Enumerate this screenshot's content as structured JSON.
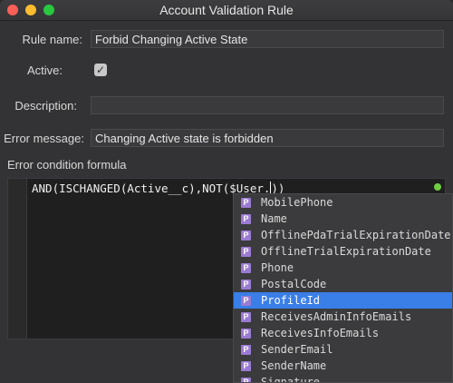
{
  "window": {
    "title": "Account Validation Rule"
  },
  "form": {
    "rule_name_label": "Rule name:",
    "rule_name_value": "Forbid Changing Active State",
    "active_label": "Active:",
    "active_checked": true,
    "active_check_glyph": "✓",
    "description_label": "Description:",
    "description_value": "",
    "error_message_label": "Error message:",
    "error_message_value": "Changing Active state is forbidden",
    "formula_label": "Error condition formula"
  },
  "editor": {
    "code_before_caret": "AND(ISCHANGED(Active__c),NOT($User.",
    "code_after_caret": "))",
    "status_color": "#6fcf3f"
  },
  "autocomplete": {
    "icon_letter": "P",
    "icon_name": "property-icon",
    "selected_index": 6,
    "items": [
      "MobilePhone",
      "Name",
      "OfflinePdaTrialExpirationDate",
      "OfflineTrialExpirationDate",
      "Phone",
      "PostalCode",
      "ProfileId",
      "ReceivesAdminInfoEmails",
      "ReceivesInfoEmails",
      "SenderEmail",
      "SenderName",
      "Signature"
    ]
  },
  "colors": {
    "selection": "#3a7ee8",
    "property_icon": "#9a7bd3"
  }
}
